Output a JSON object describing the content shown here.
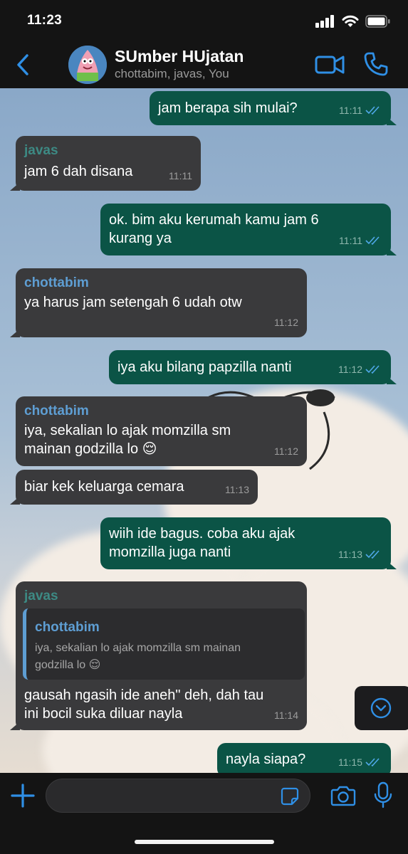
{
  "status": {
    "time": "11:23"
  },
  "header": {
    "title": "SUmber HUjatan",
    "subtitle": "chottabim, javas, You"
  },
  "colors": {
    "accent": "#2f8fe5",
    "outgoing": "#0b5446",
    "incoming": "#3a3a3c",
    "javas": "#3d8a84",
    "chottabim": "#5e9ed3"
  },
  "messages": [
    {
      "dir": "out",
      "lines": [
        "jam berapa sih mulai?"
      ],
      "time": "11:11",
      "read": true
    },
    {
      "dir": "in",
      "sender": "javas",
      "lines": [
        "jam 6 dah disana"
      ],
      "time": "11:11"
    },
    {
      "dir": "out",
      "lines": [
        "ok. bim aku kerumah kamu jam 6",
        "kurang ya"
      ],
      "time": "11:11",
      "read": true
    },
    {
      "dir": "in",
      "sender": "chottabim",
      "lines": [
        "ya harus jam setengah 6 udah otw"
      ],
      "time": "11:12"
    },
    {
      "dir": "out",
      "lines": [
        "iya aku bilang papzilla nanti"
      ],
      "time": "11:12",
      "read": true
    },
    {
      "dir": "in",
      "sender": "chottabim",
      "lines": [
        "iya, sekalian lo ajak momzilla sm",
        "mainan godzilla lo 😌"
      ],
      "time": "11:12"
    },
    {
      "dir": "in",
      "lines": [
        "biar kek keluarga cemara"
      ],
      "time": "11:13"
    },
    {
      "dir": "out",
      "lines": [
        "wiih ide bagus. coba aku ajak",
        "momzilla juga nanti"
      ],
      "time": "11:13",
      "read": true
    },
    {
      "dir": "in",
      "sender": "javas",
      "reply": {
        "sender": "chottabim",
        "lines": [
          "iya, sekalian lo ajak momzilla sm mainan",
          "godzilla lo 😌"
        ]
      },
      "lines": [
        "gausah ngasih ide aneh\" deh, dah tau",
        "ini bocil suka diluar nayla"
      ],
      "time": "11:14"
    },
    {
      "dir": "out",
      "lines": [
        "nayla siapa?"
      ],
      "time": "11:15",
      "read": true
    }
  ],
  "composer": {
    "placeholder": ""
  },
  "icons": [
    "back-chevron-icon",
    "video-call-icon",
    "phone-icon",
    "chevron-down-icon",
    "plus-icon",
    "sticker-icon",
    "camera-icon",
    "mic-icon",
    "signal-icon",
    "wifi-icon",
    "battery-icon"
  ]
}
